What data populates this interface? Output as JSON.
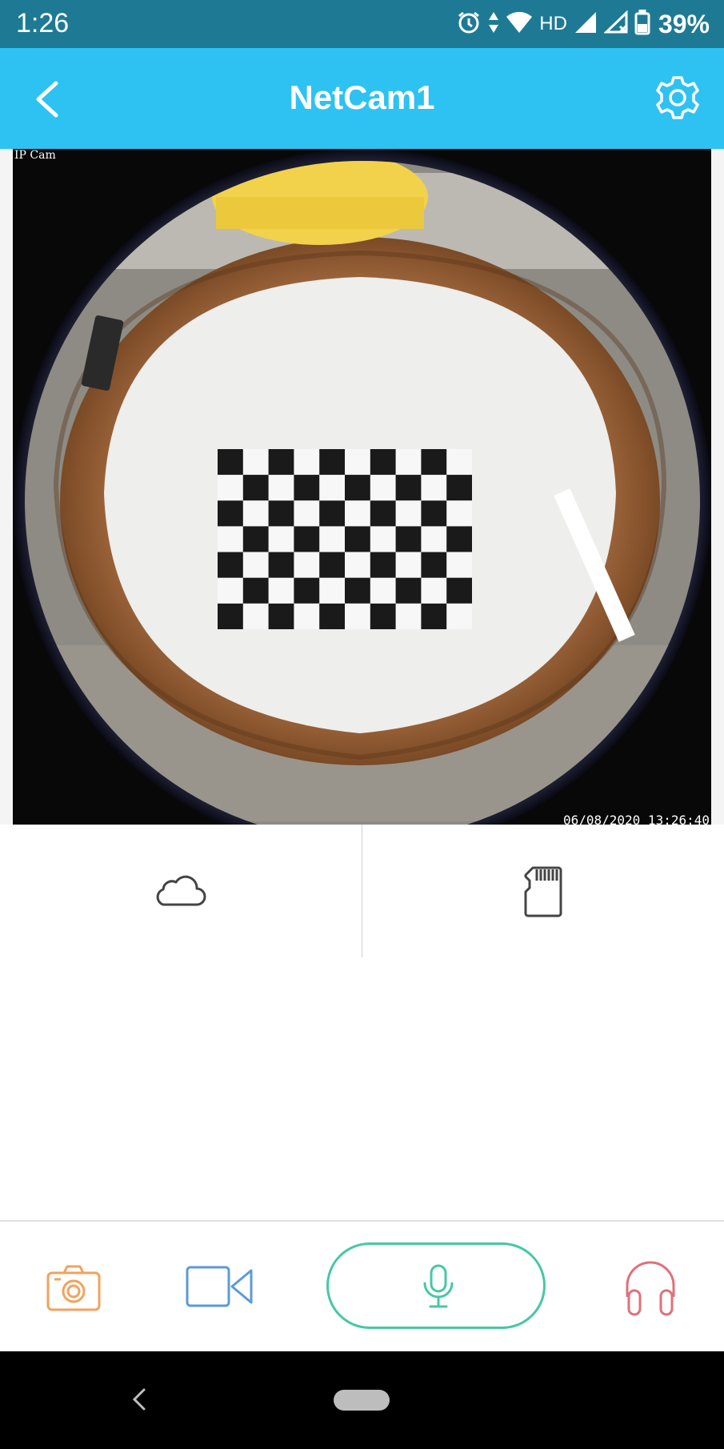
{
  "status_bar": {
    "time": "1:26",
    "network_label": "HD",
    "battery": "39%",
    "icons": [
      "alarm-icon",
      "data-transfer-icon",
      "wifi-icon",
      "signal-icon",
      "signal-no-data-icon",
      "battery-icon"
    ]
  },
  "app_bar": {
    "title": "NetCam1",
    "back_icon": "chevron-left-icon",
    "settings_icon": "gear-icon"
  },
  "video": {
    "camera_label": "IP Cam",
    "timestamp": "06/08/2020 13:26:40"
  },
  "storage": {
    "cloud_icon": "cloud-icon",
    "sd_icon": "sd-card-icon"
  },
  "controls": {
    "snapshot_icon": "camera-icon",
    "record_icon": "video-camera-icon",
    "talk_icon": "microphone-icon",
    "listen_icon": "headphones-icon",
    "colors": {
      "snapshot": "#f0a35e",
      "record": "#5b9bd5",
      "talk": "#47c7a5",
      "listen": "#e0707a"
    }
  },
  "nav_bar": {
    "back_icon": "nav-back-icon",
    "home_icon": "nav-home-pill"
  },
  "colors": {
    "status_bar": "#1e7a94",
    "app_bar": "#2ec2f2"
  }
}
